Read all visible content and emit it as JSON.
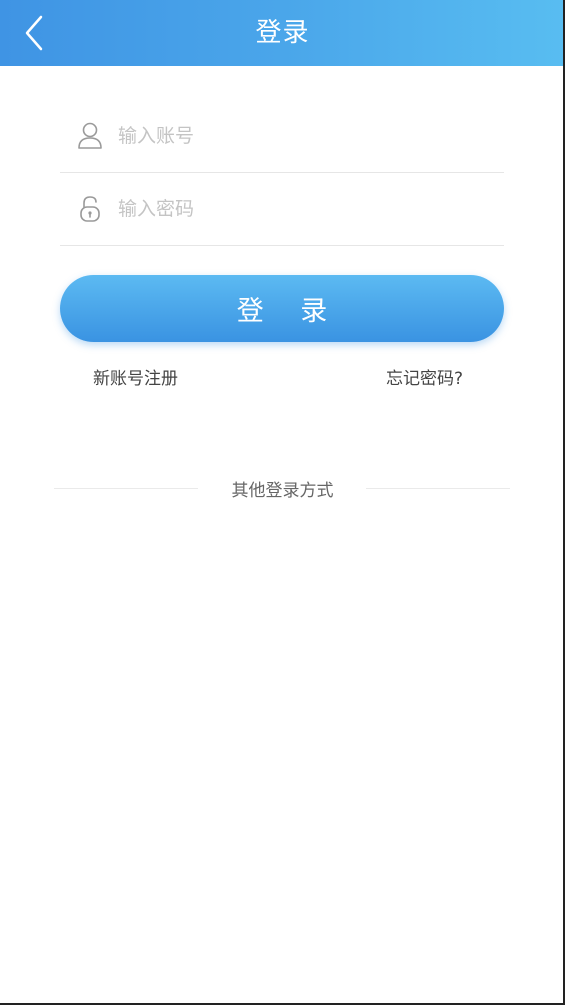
{
  "header": {
    "title": "登录"
  },
  "form": {
    "account_placeholder": "输入账号",
    "password_placeholder": "输入密码",
    "login_label": "登 录"
  },
  "links": {
    "register": "新账号注册",
    "forgot": "忘记密码?"
  },
  "other_login": {
    "label": "其他登录方式"
  },
  "colors": {
    "header_start": "#3f94e4",
    "header_end": "#58bdf1",
    "button_top": "#5cbaf2",
    "button_bottom": "#3a93e2"
  },
  "icons": {
    "back": "chevron-left-icon",
    "account": "user-icon",
    "password": "unlock-icon"
  }
}
